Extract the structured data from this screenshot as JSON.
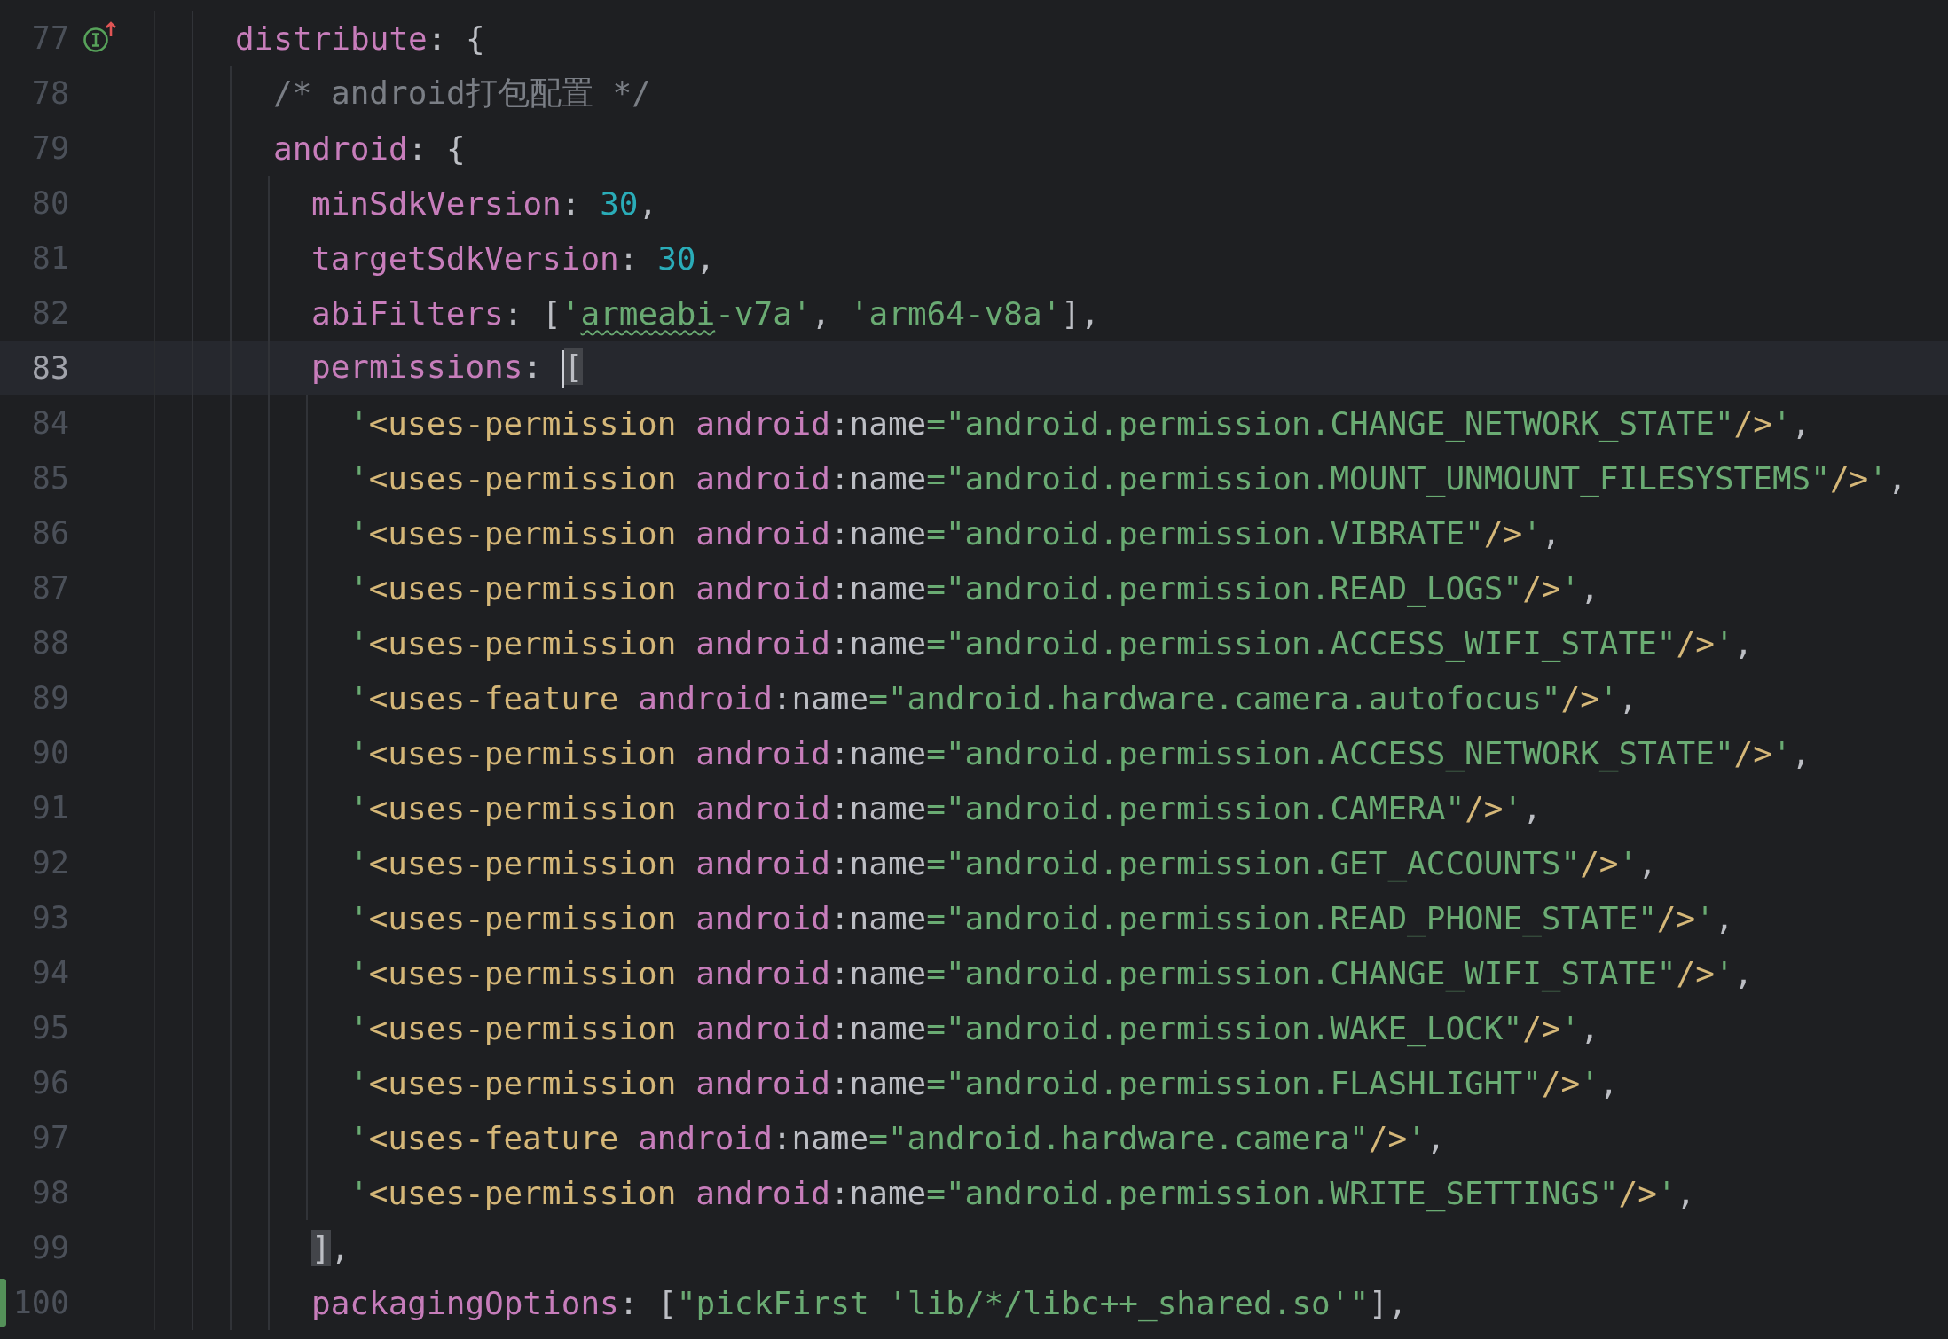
{
  "lines": [
    {
      "number": "77",
      "current": false,
      "changed": false,
      "implements": true,
      "tokens": [
        {
          "kind": "key",
          "text": "distribute"
        },
        {
          "kind": "punct",
          "text": ": {"
        }
      ],
      "children": [
        {
          "number": "78",
          "current": false,
          "changed": false,
          "tokens": [
            {
              "kind": "comment",
              "text": "/* android打包配置 */"
            }
          ]
        },
        {
          "number": "79",
          "current": false,
          "changed": false,
          "tokens": [
            {
              "kind": "key",
              "text": "android"
            },
            {
              "kind": "punct",
              "text": ": {"
            }
          ],
          "children": [
            {
              "number": "80",
              "current": false,
              "changed": false,
              "tokens": [
                {
                  "kind": "key",
                  "text": "minSdkVersion"
                },
                {
                  "kind": "punct",
                  "text": ": "
                },
                {
                  "kind": "number",
                  "text": "30"
                },
                {
                  "kind": "punct",
                  "text": ","
                }
              ]
            },
            {
              "number": "81",
              "current": false,
              "changed": false,
              "tokens": [
                {
                  "kind": "key",
                  "text": "targetSdkVersion"
                },
                {
                  "kind": "punct",
                  "text": ": "
                },
                {
                  "kind": "number",
                  "text": "30"
                },
                {
                  "kind": "punct",
                  "text": ","
                }
              ]
            },
            {
              "number": "82",
              "current": false,
              "changed": false,
              "tokens": [
                {
                  "kind": "key",
                  "text": "abiFilters"
                },
                {
                  "kind": "punct",
                  "text": ": ["
                },
                {
                  "kind": "string",
                  "text": "'"
                },
                {
                  "kind": "string",
                  "text": "armeabi",
                  "typo": true
                },
                {
                  "kind": "string",
                  "text": "-v7a'"
                },
                {
                  "kind": "punct",
                  "text": ", "
                },
                {
                  "kind": "string",
                  "text": "'arm64-v8a'"
                },
                {
                  "kind": "punct",
                  "text": "],"
                }
              ]
            },
            {
              "number": "83",
              "current": true,
              "changed": false,
              "tokens": [
                {
                  "kind": "key",
                  "text": "permissions"
                },
                {
                  "kind": "punct",
                  "text": ": "
                },
                {
                  "kind": "punct",
                  "text": "[",
                  "matched": true,
                  "caret": true
                }
              ],
              "children": [
                {
                  "number": "84",
                  "current": false,
                  "changed": false,
                  "tokens": [
                    {
                      "kind": "string",
                      "text": "'"
                    },
                    {
                      "kind": "tag",
                      "text": "<uses-permission "
                    },
                    {
                      "kind": "attr",
                      "text": "android"
                    },
                    {
                      "kind": "punct",
                      "text": ":name"
                    },
                    {
                      "kind": "string",
                      "text": "=\"android.permission.CHANGE_NETWORK_STATE\""
                    },
                    {
                      "kind": "tag",
                      "text": "/>"
                    },
                    {
                      "kind": "string",
                      "text": "'"
                    },
                    {
                      "kind": "punct",
                      "text": ","
                    }
                  ]
                },
                {
                  "number": "85",
                  "current": false,
                  "changed": false,
                  "tokens": [
                    {
                      "kind": "string",
                      "text": "'"
                    },
                    {
                      "kind": "tag",
                      "text": "<uses-permission "
                    },
                    {
                      "kind": "attr",
                      "text": "android"
                    },
                    {
                      "kind": "punct",
                      "text": ":name"
                    },
                    {
                      "kind": "string",
                      "text": "=\"android.permission.MOUNT_UNMOUNT_FILESYSTEMS\""
                    },
                    {
                      "kind": "tag",
                      "text": "/>"
                    },
                    {
                      "kind": "string",
                      "text": "'"
                    },
                    {
                      "kind": "punct",
                      "text": ","
                    }
                  ]
                },
                {
                  "number": "86",
                  "current": false,
                  "changed": false,
                  "tokens": [
                    {
                      "kind": "string",
                      "text": "'"
                    },
                    {
                      "kind": "tag",
                      "text": "<uses-permission "
                    },
                    {
                      "kind": "attr",
                      "text": "android"
                    },
                    {
                      "kind": "punct",
                      "text": ":name"
                    },
                    {
                      "kind": "string",
                      "text": "=\"android.permission.VIBRATE\""
                    },
                    {
                      "kind": "tag",
                      "text": "/>"
                    },
                    {
                      "kind": "string",
                      "text": "'"
                    },
                    {
                      "kind": "punct",
                      "text": ","
                    }
                  ]
                },
                {
                  "number": "87",
                  "current": false,
                  "changed": false,
                  "tokens": [
                    {
                      "kind": "string",
                      "text": "'"
                    },
                    {
                      "kind": "tag",
                      "text": "<uses-permission "
                    },
                    {
                      "kind": "attr",
                      "text": "android"
                    },
                    {
                      "kind": "punct",
                      "text": ":name"
                    },
                    {
                      "kind": "string",
                      "text": "=\"android.permission.READ_LOGS\""
                    },
                    {
                      "kind": "tag",
                      "text": "/>"
                    },
                    {
                      "kind": "string",
                      "text": "'"
                    },
                    {
                      "kind": "punct",
                      "text": ","
                    }
                  ]
                },
                {
                  "number": "88",
                  "current": false,
                  "changed": false,
                  "tokens": [
                    {
                      "kind": "string",
                      "text": "'"
                    },
                    {
                      "kind": "tag",
                      "text": "<uses-permission "
                    },
                    {
                      "kind": "attr",
                      "text": "android"
                    },
                    {
                      "kind": "punct",
                      "text": ":name"
                    },
                    {
                      "kind": "string",
                      "text": "=\"android.permission.ACCESS_WIFI_STATE\""
                    },
                    {
                      "kind": "tag",
                      "text": "/>"
                    },
                    {
                      "kind": "string",
                      "text": "'"
                    },
                    {
                      "kind": "punct",
                      "text": ","
                    }
                  ]
                },
                {
                  "number": "89",
                  "current": false,
                  "changed": false,
                  "tokens": [
                    {
                      "kind": "string",
                      "text": "'"
                    },
                    {
                      "kind": "tag",
                      "text": "<uses-feature "
                    },
                    {
                      "kind": "attr",
                      "text": "android"
                    },
                    {
                      "kind": "punct",
                      "text": ":name"
                    },
                    {
                      "kind": "string",
                      "text": "=\"android.hardware.camera.autofocus\""
                    },
                    {
                      "kind": "tag",
                      "text": "/>"
                    },
                    {
                      "kind": "string",
                      "text": "'"
                    },
                    {
                      "kind": "punct",
                      "text": ","
                    }
                  ]
                },
                {
                  "number": "90",
                  "current": false,
                  "changed": false,
                  "tokens": [
                    {
                      "kind": "string",
                      "text": "'"
                    },
                    {
                      "kind": "tag",
                      "text": "<uses-permission "
                    },
                    {
                      "kind": "attr",
                      "text": "android"
                    },
                    {
                      "kind": "punct",
                      "text": ":name"
                    },
                    {
                      "kind": "string",
                      "text": "=\"android.permission.ACCESS_NETWORK_STATE\""
                    },
                    {
                      "kind": "tag",
                      "text": "/>"
                    },
                    {
                      "kind": "string",
                      "text": "'"
                    },
                    {
                      "kind": "punct",
                      "text": ","
                    }
                  ]
                },
                {
                  "number": "91",
                  "current": false,
                  "changed": false,
                  "tokens": [
                    {
                      "kind": "string",
                      "text": "'"
                    },
                    {
                      "kind": "tag",
                      "text": "<uses-permission "
                    },
                    {
                      "kind": "attr",
                      "text": "android"
                    },
                    {
                      "kind": "punct",
                      "text": ":name"
                    },
                    {
                      "kind": "string",
                      "text": "=\"android.permission.CAMERA\""
                    },
                    {
                      "kind": "tag",
                      "text": "/>"
                    },
                    {
                      "kind": "string",
                      "text": "'"
                    },
                    {
                      "kind": "punct",
                      "text": ","
                    }
                  ]
                },
                {
                  "number": "92",
                  "current": false,
                  "changed": false,
                  "tokens": [
                    {
                      "kind": "string",
                      "text": "'"
                    },
                    {
                      "kind": "tag",
                      "text": "<uses-permission "
                    },
                    {
                      "kind": "attr",
                      "text": "android"
                    },
                    {
                      "kind": "punct",
                      "text": ":name"
                    },
                    {
                      "kind": "string",
                      "text": "=\"android.permission.GET_ACCOUNTS\""
                    },
                    {
                      "kind": "tag",
                      "text": "/>"
                    },
                    {
                      "kind": "string",
                      "text": "'"
                    },
                    {
                      "kind": "punct",
                      "text": ","
                    }
                  ]
                },
                {
                  "number": "93",
                  "current": false,
                  "changed": false,
                  "tokens": [
                    {
                      "kind": "string",
                      "text": "'"
                    },
                    {
                      "kind": "tag",
                      "text": "<uses-permission "
                    },
                    {
                      "kind": "attr",
                      "text": "android"
                    },
                    {
                      "kind": "punct",
                      "text": ":name"
                    },
                    {
                      "kind": "string",
                      "text": "=\"android.permission.READ_PHONE_STATE\""
                    },
                    {
                      "kind": "tag",
                      "text": "/>"
                    },
                    {
                      "kind": "string",
                      "text": "'"
                    },
                    {
                      "kind": "punct",
                      "text": ","
                    }
                  ]
                },
                {
                  "number": "94",
                  "current": false,
                  "changed": false,
                  "tokens": [
                    {
                      "kind": "string",
                      "text": "'"
                    },
                    {
                      "kind": "tag",
                      "text": "<uses-permission "
                    },
                    {
                      "kind": "attr",
                      "text": "android"
                    },
                    {
                      "kind": "punct",
                      "text": ":name"
                    },
                    {
                      "kind": "string",
                      "text": "=\"android.permission.CHANGE_WIFI_STATE\""
                    },
                    {
                      "kind": "tag",
                      "text": "/>"
                    },
                    {
                      "kind": "string",
                      "text": "'"
                    },
                    {
                      "kind": "punct",
                      "text": ","
                    }
                  ]
                },
                {
                  "number": "95",
                  "current": false,
                  "changed": false,
                  "tokens": [
                    {
                      "kind": "string",
                      "text": "'"
                    },
                    {
                      "kind": "tag",
                      "text": "<uses-permission "
                    },
                    {
                      "kind": "attr",
                      "text": "android"
                    },
                    {
                      "kind": "punct",
                      "text": ":name"
                    },
                    {
                      "kind": "string",
                      "text": "=\"android.permission.WAKE_LOCK\""
                    },
                    {
                      "kind": "tag",
                      "text": "/>"
                    },
                    {
                      "kind": "string",
                      "text": "'"
                    },
                    {
                      "kind": "punct",
                      "text": ","
                    }
                  ]
                },
                {
                  "number": "96",
                  "current": false,
                  "changed": false,
                  "tokens": [
                    {
                      "kind": "string",
                      "text": "'"
                    },
                    {
                      "kind": "tag",
                      "text": "<uses-permission "
                    },
                    {
                      "kind": "attr",
                      "text": "android"
                    },
                    {
                      "kind": "punct",
                      "text": ":name"
                    },
                    {
                      "kind": "string",
                      "text": "=\"android.permission.FLASHLIGHT\""
                    },
                    {
                      "kind": "tag",
                      "text": "/>"
                    },
                    {
                      "kind": "string",
                      "text": "'"
                    },
                    {
                      "kind": "punct",
                      "text": ","
                    }
                  ]
                },
                {
                  "number": "97",
                  "current": false,
                  "changed": false,
                  "tokens": [
                    {
                      "kind": "string",
                      "text": "'"
                    },
                    {
                      "kind": "tag",
                      "text": "<uses-feature "
                    },
                    {
                      "kind": "attr",
                      "text": "android"
                    },
                    {
                      "kind": "punct",
                      "text": ":name"
                    },
                    {
                      "kind": "string",
                      "text": "=\"android.hardware.camera\""
                    },
                    {
                      "kind": "tag",
                      "text": "/>"
                    },
                    {
                      "kind": "string",
                      "text": "'"
                    },
                    {
                      "kind": "punct",
                      "text": ","
                    }
                  ]
                },
                {
                  "number": "98",
                  "current": false,
                  "changed": false,
                  "tokens": [
                    {
                      "kind": "string",
                      "text": "'"
                    },
                    {
                      "kind": "tag",
                      "text": "<uses-permission "
                    },
                    {
                      "kind": "attr",
                      "text": "android"
                    },
                    {
                      "kind": "punct",
                      "text": ":name"
                    },
                    {
                      "kind": "string",
                      "text": "=\"android.permission.WRITE_SETTINGS\""
                    },
                    {
                      "kind": "tag",
                      "text": "/>"
                    },
                    {
                      "kind": "string",
                      "text": "'"
                    },
                    {
                      "kind": "punct",
                      "text": ","
                    }
                  ]
                }
              ]
            },
            {
              "number": "99",
              "current": false,
              "changed": false,
              "tokens": [
                {
                  "kind": "punct",
                  "text": "]",
                  "matched": true
                },
                {
                  "kind": "punct",
                  "text": ","
                }
              ]
            },
            {
              "number": "100",
              "current": false,
              "changed": true,
              "tokens": [
                {
                  "kind": "key",
                  "text": "packagingOptions"
                },
                {
                  "kind": "punct",
                  "text": ": ["
                },
                {
                  "kind": "string",
                  "text": "\"pickFirst 'lib/*/libc++_shared.so'\""
                },
                {
                  "kind": "punct",
                  "text": "],"
                }
              ]
            }
          ]
        }
      ]
    }
  ]
}
